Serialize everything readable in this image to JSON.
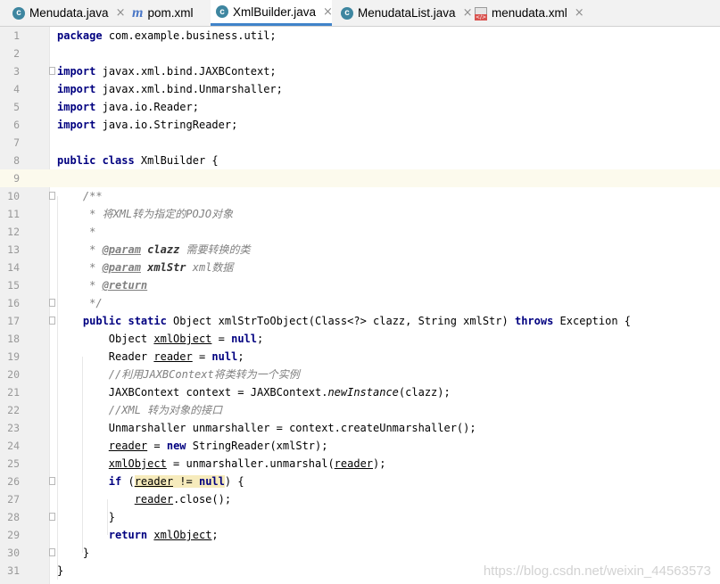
{
  "tabs": [
    {
      "label": "Menudata.java",
      "icon": "class-c-icon",
      "glyph": "c",
      "active": false,
      "close": "×"
    },
    {
      "label": "pom.xml",
      "icon": "maven-m-icon",
      "glyph": "m",
      "active": false,
      "close": ""
    },
    {
      "label": "XmlBuilder.java",
      "icon": "class-c-icon",
      "glyph": "c",
      "active": true,
      "close": "×"
    },
    {
      "label": "MenudataList.java",
      "icon": "class-c-icon",
      "glyph": "c",
      "active": false,
      "close": "×"
    },
    {
      "label": "menudata.xml",
      "icon": "xml-file-icon",
      "glyph": "</>",
      "active": false,
      "close": "×"
    }
  ],
  "current_line": 9,
  "lines": [
    [
      [
        "kw",
        "package"
      ],
      [
        "",
        "com.example.business.util;"
      ]
    ],
    [],
    [
      [
        "kw",
        "import"
      ],
      [
        "",
        "javax.xml.bind.JAXBContext;"
      ]
    ],
    [
      [
        "kw",
        "import"
      ],
      [
        "",
        "javax.xml.bind.Unmarshaller;"
      ]
    ],
    [
      [
        "kw",
        "import"
      ],
      [
        "",
        "java.io.Reader;"
      ]
    ],
    [
      [
        "kw",
        "import"
      ],
      [
        "",
        "java.io.StringReader;"
      ]
    ],
    [],
    [
      [
        "kw",
        "public class"
      ],
      [
        "",
        " XmlBuilder {"
      ]
    ],
    [],
    [
      [
        "doc",
        "    /**"
      ]
    ],
    [
      [
        "doc",
        "     * 将XML转为指定的POJO对象"
      ]
    ],
    [
      [
        "doc",
        "     *"
      ]
    ],
    [
      [
        "doc",
        "     * "
      ],
      [
        "tag",
        "@param"
      ],
      [
        "doc",
        " "
      ],
      [
        "docb",
        "clazz"
      ],
      [
        "doc",
        " 需要转换的类"
      ]
    ],
    [
      [
        "doc",
        "     * "
      ],
      [
        "tag",
        "@param"
      ],
      [
        "doc",
        " "
      ],
      [
        "docb",
        "xmlStr"
      ],
      [
        "doc",
        " xml数据"
      ]
    ],
    [
      [
        "doc",
        "     * "
      ],
      [
        "tag",
        "@return"
      ]
    ],
    [
      [
        "doc",
        "     */"
      ]
    ],
    [
      [
        "",
        "    "
      ],
      [
        "kw",
        "public static"
      ],
      [
        "",
        " Object xmlStrToObject(Class<?> clazz, String xmlStr) "
      ],
      [
        "kw",
        "throws"
      ],
      [
        "",
        " Exception {"
      ]
    ],
    [
      [
        "",
        "        Object "
      ],
      [
        "u",
        "xmlObject"
      ],
      [
        "",
        " = "
      ],
      [
        "kw",
        "null"
      ],
      [
        "",
        ";"
      ]
    ],
    [
      [
        "",
        "        Reader "
      ],
      [
        "u",
        "reader"
      ],
      [
        "",
        " = "
      ],
      [
        "kw",
        "null"
      ],
      [
        "",
        ";"
      ]
    ],
    [
      [
        "cmt",
        "        //利用JAXBContext将类转为一个实例"
      ]
    ],
    [
      [
        "",
        "        JAXBContext context = JAXBContext."
      ],
      [
        "it",
        "newInstance"
      ],
      [
        "",
        "(clazz);"
      ]
    ],
    [
      [
        "cmt",
        "        //XML 转为对象的接口"
      ]
    ],
    [
      [
        "",
        "        Unmarshaller unmarshaller = context.createUnmarshaller();"
      ]
    ],
    [
      [
        "",
        "        "
      ],
      [
        "u",
        "reader"
      ],
      [
        "",
        " = "
      ],
      [
        "kw",
        "new"
      ],
      [
        "",
        " StringReader(xmlStr);"
      ]
    ],
    [
      [
        "",
        "        "
      ],
      [
        "u",
        "xmlObject"
      ],
      [
        "",
        " = unmarshaller.unmarshal("
      ],
      [
        "u",
        "reader"
      ],
      [
        "",
        ");"
      ]
    ],
    [
      [
        "",
        "        "
      ],
      [
        "kw",
        "if"
      ],
      [
        "",
        " ("
      ],
      [
        "hlu",
        "reader"
      ],
      [
        "hl",
        " != "
      ],
      [
        "hlkw",
        "null"
      ],
      [
        "",
        ") {"
      ]
    ],
    [
      [
        "",
        "            "
      ],
      [
        "u",
        "reader"
      ],
      [
        "",
        ".close();"
      ]
    ],
    [
      [
        "",
        "        }"
      ]
    ],
    [
      [
        "",
        "        "
      ],
      [
        "kw",
        "return"
      ],
      [
        "",
        " "
      ],
      [
        "u",
        "xmlObject"
      ],
      [
        "",
        ";"
      ]
    ],
    [
      [
        "",
        "    }"
      ]
    ],
    [
      [
        "",
        "}"
      ]
    ]
  ],
  "watermark": "https://blog.csdn.net/weixin_44563573"
}
